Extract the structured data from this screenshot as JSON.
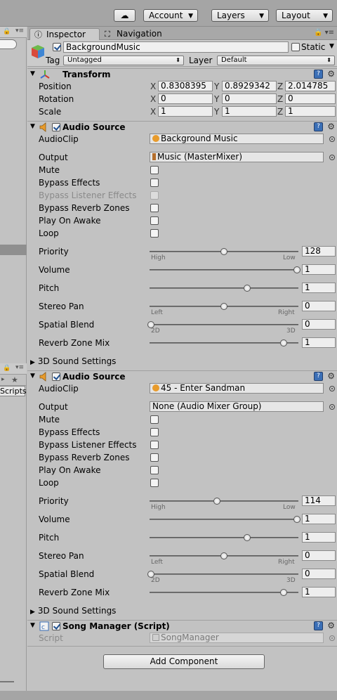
{
  "toolbar": {
    "account_label": "Account",
    "layers_label": "Layers",
    "layout_label": "Layout"
  },
  "left_panel": {
    "scripts_label": "Scripts"
  },
  "tabs": {
    "inspector": "Inspector",
    "navigation": "Navigation"
  },
  "gameobject": {
    "name": "BackgroundMusic",
    "static_label": "Static",
    "tag_label": "Tag",
    "tag_value": "Untagged",
    "layer_label": "Layer",
    "layer_value": "Default"
  },
  "transform": {
    "title": "Transform",
    "position_label": "Position",
    "rotation_label": "Rotation",
    "scale_label": "Scale",
    "axis_x": "X",
    "axis_y": "Y",
    "axis_z": "Z",
    "position": {
      "x": "0.8308395",
      "y": "0.8929342",
      "z": "2.014785"
    },
    "rotation": {
      "x": "0",
      "y": "0",
      "z": "0"
    },
    "scale": {
      "x": "1",
      "y": "1",
      "z": "1"
    }
  },
  "labels": {
    "audioclip": "AudioClip",
    "output": "Output",
    "mute": "Mute",
    "bypass_effects": "Bypass Effects",
    "bypass_listener": "Bypass Listener Effects",
    "bypass_reverb": "Bypass Reverb Zones",
    "play_on_awake": "Play On Awake",
    "loop": "Loop",
    "priority": "Priority",
    "volume": "Volume",
    "pitch": "Pitch",
    "stereo_pan": "Stereo Pan",
    "spatial_blend": "Spatial Blend",
    "reverb_zone_mix": "Reverb Zone Mix",
    "sound_3d": "3D Sound Settings",
    "high": "High",
    "low": "Low",
    "left": "Left",
    "right": "Right",
    "d2": "2D",
    "d3": "3D"
  },
  "audio1": {
    "title": "Audio Source",
    "clip": "Background Music",
    "output": "Music (MasterMixer)",
    "priority": "128",
    "volume": "1",
    "pitch": "1",
    "stereo_pan": "0",
    "spatial_blend": "0",
    "reverb_zone_mix": "1",
    "slider_fraction": {
      "priority": 0.5,
      "volume": 1.0,
      "pitch": 0.66,
      "stereo_pan": 0.5,
      "spatial_blend": 0.0,
      "reverb_zone_mix": 0.91
    }
  },
  "audio2": {
    "title": "Audio Source",
    "clip": "45 - Enter Sandman",
    "output": "None (Audio Mixer Group)",
    "priority": "114",
    "volume": "1",
    "pitch": "1",
    "stereo_pan": "0",
    "spatial_blend": "0",
    "reverb_zone_mix": "1",
    "slider_fraction": {
      "priority": 0.45,
      "volume": 1.0,
      "pitch": 0.66,
      "stereo_pan": 0.5,
      "spatial_blend": 0.0,
      "reverb_zone_mix": 0.91
    }
  },
  "song_manager": {
    "title": "Song Manager (Script)",
    "script_label": "Script",
    "script_value": "SongManager"
  },
  "add_component_label": "Add Component",
  "colors": {
    "panel": "#c2c2c2",
    "help_icon": "#3b6fb6",
    "audio_icon": "#e89b2c"
  }
}
